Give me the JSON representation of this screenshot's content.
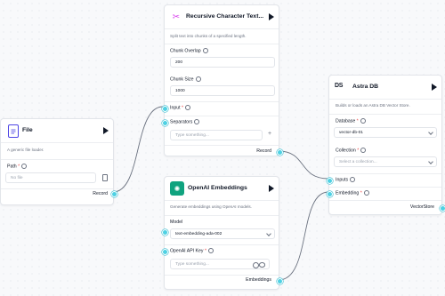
{
  "colors": {
    "accent": "#4fd1e3",
    "edge": "#6b7280",
    "openai_icon": "#10a37f",
    "splitter_icon": "#d946ef",
    "file_icon": "#4f46e5"
  },
  "file_node": {
    "title": "File",
    "icon": "file-icon",
    "description": "A generic file loader.",
    "path_label": "Path",
    "path_placeholder": "No file",
    "output_label": "Record"
  },
  "splitter_node": {
    "title": "Recursive Character Text...",
    "icon": "scissors-icon",
    "description": "Split text into chunks of a specified length.",
    "chunk_overlap_label": "Chunk Overlap",
    "chunk_overlap_value": "200",
    "chunk_size_label": "Chunk Size",
    "chunk_size_value": "1000",
    "input_label": "Input",
    "separators_label": "Separators",
    "separators_placeholder": "Type something...",
    "output_label": "Record"
  },
  "embeddings_node": {
    "title": "OpenAI Embeddings",
    "icon": "openai-icon",
    "description": "Generate embeddings using OpenAI models.",
    "model_label": "Model",
    "model_value": "text-embedding-ada-002",
    "api_key_label": "OpenAI API Key",
    "api_key_placeholder": "Type something...",
    "output_label": "Embeddings"
  },
  "astra_node": {
    "title": "Astra DB",
    "icon_text": "DS",
    "description": "Builds or loads an Astra DB Vector Store.",
    "database_label": "Database",
    "database_value": "vector-db-01",
    "collection_label": "Collection",
    "collection_placeholder": "Select a collection...",
    "inputs_label": "Inputs",
    "embedding_label": "Embedding",
    "output_label": "VectorStore"
  }
}
